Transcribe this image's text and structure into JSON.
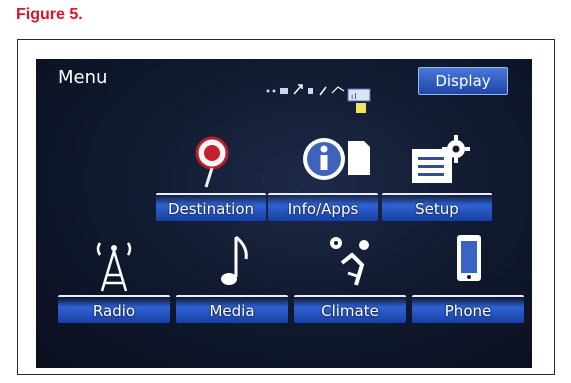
{
  "figure": {
    "title": "Figure 5."
  },
  "screen": {
    "title": "Menu",
    "display_button": "Display",
    "status_indicator_text": "••• ↗ • ↗"
  },
  "tiles": [
    {
      "label": "Destination",
      "icon": "map-pin-icon"
    },
    {
      "label": "Info/Apps",
      "icon": "info-icon"
    },
    {
      "label": "Setup",
      "icon": "settings-gear-icon"
    },
    {
      "label": "Radio",
      "icon": "radio-tower-icon"
    },
    {
      "label": "Media",
      "icon": "music-note-icon"
    },
    {
      "label": "Climate",
      "icon": "climate-icon"
    },
    {
      "label": "Phone",
      "icon": "phone-icon"
    }
  ],
  "colors": {
    "figure_title": "#e0112b",
    "screen_bg": "#111a30",
    "accent_blue": "#2e63d6"
  }
}
